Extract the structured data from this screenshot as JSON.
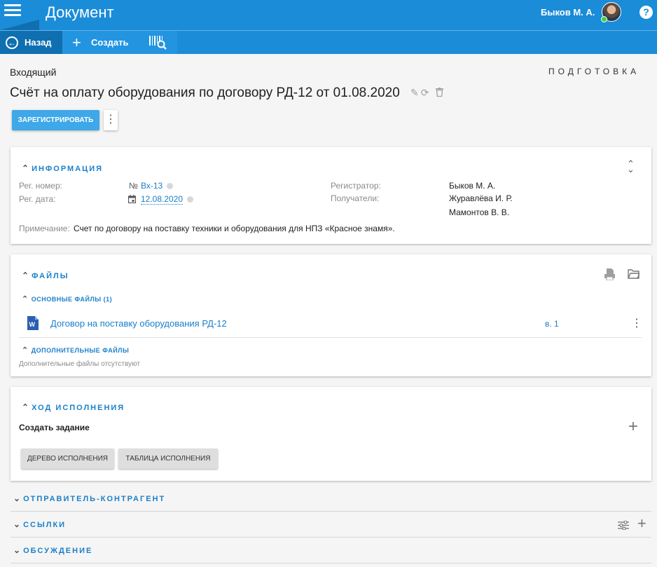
{
  "app": {
    "title": "Документ",
    "user_name": "Быков М. А.",
    "help_icon": "?"
  },
  "toolbar": {
    "back_label": "Назад",
    "create_label": "Создать"
  },
  "document": {
    "type": "Входящий",
    "status": "ПОДГОТОВКА",
    "title": "Счёт на оплату оборудования по договору РД-12 от 01.08.2020",
    "register_button": "ЗАРЕГИСТРИРОВАТЬ"
  },
  "info": {
    "section_title": "ИНФОРМАЦИЯ",
    "reg_number_label": "Рег. номер:",
    "reg_number_value": "Вх-13",
    "reg_date_label": "Рег. дата:",
    "reg_date_value": "12.08.2020",
    "registrar_label": "Регистратор:",
    "registrar_value": "Быков М. А.",
    "recipients_label": "Получатели:",
    "recipients": [
      "Журавлёва И. Р.",
      "Мамонтов В. В."
    ],
    "note_label": "Примечание:",
    "note_value": "Счет по договору на поставку техники и оборудования для НПЗ «Красное знамя»."
  },
  "files": {
    "section_title": "ФАЙЛЫ",
    "main_files_title": "ОСНОВНЫЕ ФАЙЛЫ (1)",
    "file_name": "Договор на поставку оборудования РД-12",
    "file_version": "в. 1",
    "extra_files_title": "ДОПОЛНИТЕЛЬНЫЕ ФАЙЛЫ",
    "extra_files_empty": "Дополнительные файлы отсутствуют"
  },
  "execution": {
    "section_title": "ХОД ИСПОЛНЕНИЯ",
    "create_task": "Создать задание",
    "tree_button": "ДЕРЕВО ИСПОЛНЕНИЯ",
    "table_button": "ТАБЛИЦА ИСПОЛНЕНИЯ"
  },
  "collapsed_sections": {
    "sender": "ОТПРАВИТЕЛЬ-КОНТРАГЕНТ",
    "links": "ССЫЛКИ",
    "discussion": "ОБСУЖДЕНИЕ"
  },
  "colors": {
    "header_blue": "#1a8cd8",
    "accent_blue": "#1a7fc9",
    "register_button": "#3ea8e8"
  }
}
